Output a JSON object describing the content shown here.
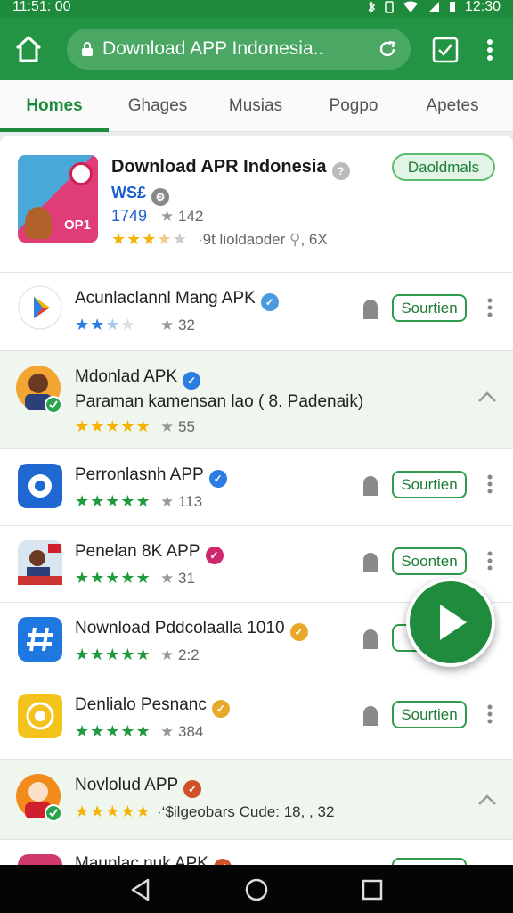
{
  "status": {
    "time": "11:51: 00",
    "clock_right": "12:30"
  },
  "browser": {
    "url_text": "Download APP Indonesia.."
  },
  "tabs": [
    "Homes",
    "Ghages",
    "Musias",
    "Pogpo",
    "Apetes"
  ],
  "featured": {
    "title": "Download APR Indonesia",
    "tag": "WS£",
    "number": "1749",
    "rating_count": "142",
    "extra": "·9t lioldaoder",
    "extra_count": ", 6X",
    "button": "Daoldmals"
  },
  "items": [
    {
      "title": "Acunlaclannl Mang APK",
      "count": "32",
      "button": "Sourtien"
    },
    {
      "title": "Mdonlad APK",
      "subtitle": "Paraman kamensan lao ( 8. Padenaik)",
      "count": "55"
    },
    {
      "title": "Perronlasnh APP",
      "count": "113",
      "button": "Sourtien"
    },
    {
      "title": "Penelan 8K APP",
      "count": "31",
      "button": "Soonten"
    },
    {
      "title": "Nownload Pddcolaalla 1010",
      "count": "2:2"
    },
    {
      "title": "Denlialo Pesnanc",
      "count": "384",
      "button": "Sourtien"
    },
    {
      "title": "Novlolud APP",
      "count": "·‘$ilgeobars Cude: 18, , 32"
    },
    {
      "title": "Maunlac nuk APK"
    }
  ],
  "icon_text": {
    "featured_label": "OP1"
  },
  "colors": {
    "brand_green": "#239443",
    "star_yellow": "#f2b400",
    "star_green": "#1f9a3c",
    "star_blue": "#2a7de1"
  }
}
